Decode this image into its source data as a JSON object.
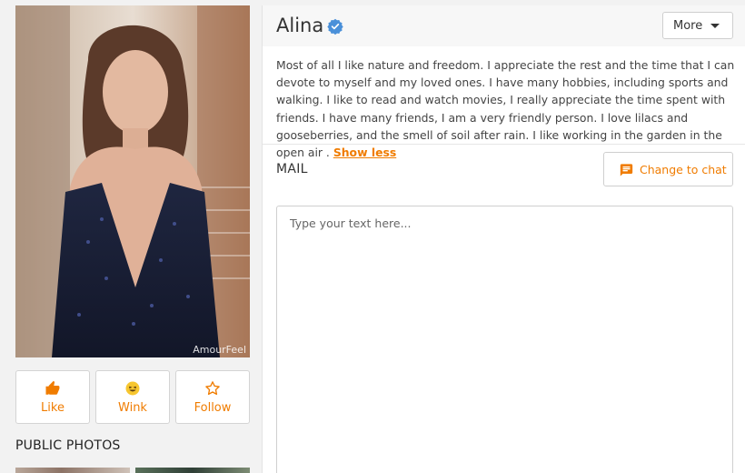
{
  "profile": {
    "photo_watermark": "AmourFeel",
    "actions": {
      "like_label": "Like",
      "wink_label": "Wink",
      "follow_label": "Follow"
    },
    "public_photos_heading": "PUBLIC PHOTOS"
  },
  "header": {
    "name": "Alina",
    "verified_icon": "verified-badge-icon",
    "more_label": "More"
  },
  "bio": {
    "text": "Most of all I like nature and freedom. I appreciate the rest and the time that I can devote to myself and my loved ones. I have many hobbies, including sports and walking. I like to read and watch movies, I really appreciate the time spent with friends. I have many friends, I am a very friendly person. I love lilacs and gooseberries, and the smell of soil after rain. I like working in the garden in the open air . ",
    "show_less_label": "Show less"
  },
  "mail": {
    "heading": "MAIL",
    "change_to_chat_label": "Change to chat",
    "placeholder": "Type your text here..."
  },
  "colors": {
    "accent": "#f07c00",
    "verified": "#4a90d9"
  }
}
